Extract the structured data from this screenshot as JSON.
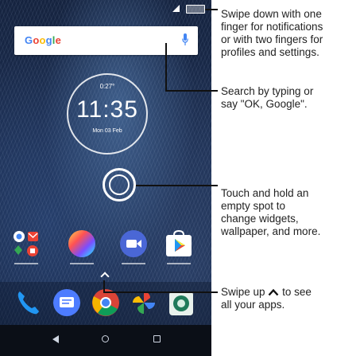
{
  "search": {
    "brand": "Google"
  },
  "clock": {
    "temp": "0:27°",
    "time": "11:35",
    "date": "Mon 03 Feb"
  },
  "callouts": {
    "notifications": "Swipe down with one\nfinger for notifications\nor with two fingers for\nprofiles and settings.",
    "search": "Search by typing or\nsay \"OK, Google\".",
    "touch_hold": "Touch and hold an\nempty spot to\nchange widgets,\nwallpaper, and more.",
    "swipe_up_prefix": "Swipe up",
    "swipe_up_suffix": "to see\nall your apps."
  },
  "home_apps": [
    "google-folder-icon",
    "photos-icon",
    "duo-icon",
    "play-store-icon"
  ],
  "dock_apps": [
    "phone-icon",
    "messages-icon",
    "chrome-icon",
    "photos-pinwheel-icon",
    "camera-icon"
  ],
  "colors": {
    "google_blue": "#4285F4",
    "google_red": "#EA4335",
    "google_yellow": "#FBBC05",
    "google_green": "#34A853"
  }
}
